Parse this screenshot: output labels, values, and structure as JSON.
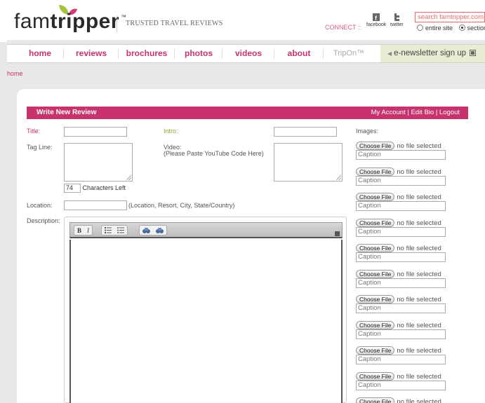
{
  "header": {
    "logo_prefix": "fam",
    "logo_suffix": "tripper",
    "logo_tm": "™",
    "tagline": "TRUSTED TRAVEL REVIEWS",
    "connect_label": "CONNECT ::",
    "facebook_label": "facebook",
    "twitter_label": "twitter",
    "search_placeholder": "search famtripper.com",
    "search_options": [
      "entire site",
      "section"
    ]
  },
  "nav": {
    "items": [
      "home",
      "reviews",
      "brochures",
      "photos",
      "videos",
      "about"
    ],
    "tripon_label": "TripOn™",
    "enewsletter_label": "e-newsletter sign up"
  },
  "breadcrumb": "home",
  "form": {
    "title_bar": "Write New Review",
    "account_links": "My Account | Edit Bio | Logout",
    "title_label": "Title:",
    "intro_label": "Intro:",
    "images_label": "Images:",
    "tagline_label": "Tag Line:",
    "video_label": "Video:",
    "video_hint": "(Please Paste YouTube Code Here)",
    "chars_left_value": "74",
    "chars_left_label": "Characters Left",
    "location_label": "Location:",
    "location_hint": "(Location, Resort, City, State/Country)",
    "description_label": "Description:",
    "toolbar": {
      "bold": "B",
      "italic": "I"
    }
  },
  "uploads": {
    "choose_label": "Choose File",
    "no_file_label": "no file selected",
    "caption_placeholder": "Caption",
    "count": 11
  },
  "colors": {
    "brand_pink": "#c8336e",
    "nav_pink": "#c6336f",
    "intro_green": "#8aac2a",
    "enews_bg": "#e7ecd3"
  }
}
